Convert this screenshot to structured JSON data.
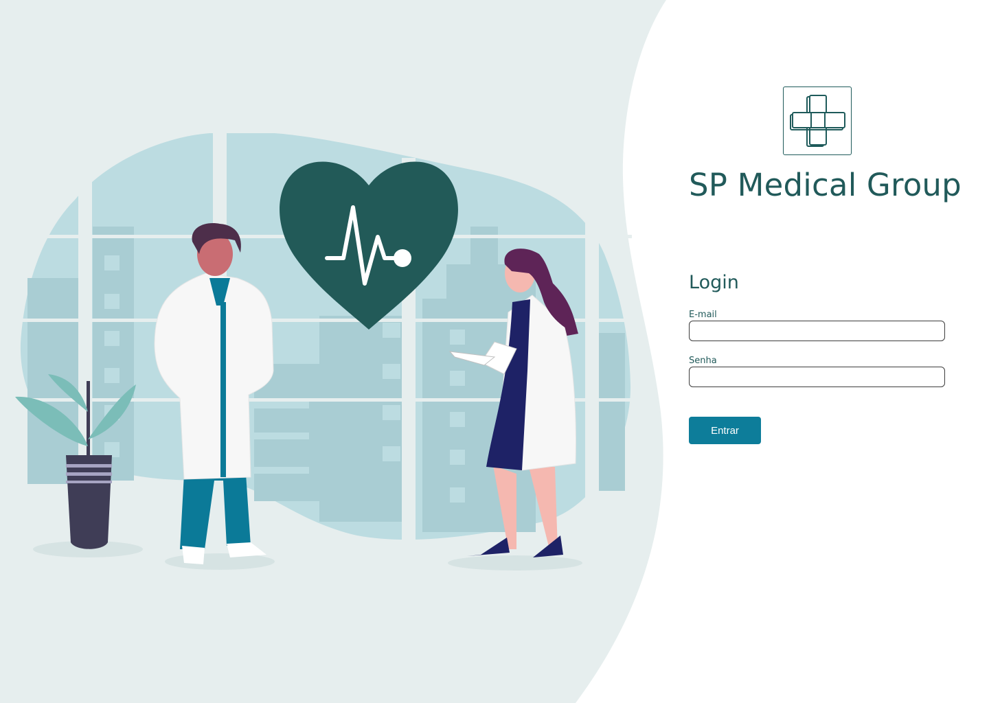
{
  "brand": {
    "name": "SP Medical Group",
    "logo_icon": "medical-cross-icon"
  },
  "login": {
    "title": "Login",
    "email_label": "E-mail",
    "email_value": "",
    "password_label": "Senha",
    "password_value": "",
    "submit_label": "Entrar"
  },
  "illustration": {
    "description_icon": "doctors-heartbeat-illustration"
  },
  "colors": {
    "primary_text": "#215a5a",
    "accent_button": "#0d7d9a",
    "heart": "#225a58",
    "panel_background": "#e6eeee",
    "window_glass": "#bcdce1"
  }
}
